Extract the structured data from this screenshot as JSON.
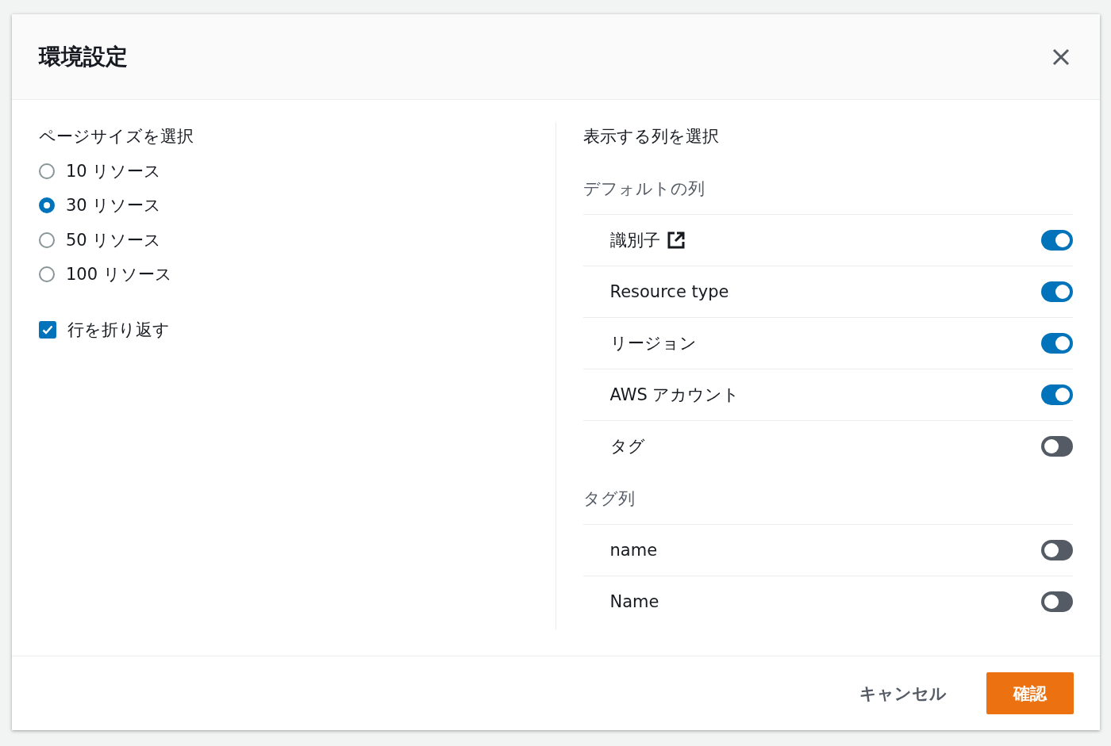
{
  "dialog": {
    "title": "環境設定"
  },
  "page_size": {
    "label": "ページサイズを選択",
    "options": [
      {
        "label": "10 リソース",
        "selected": false
      },
      {
        "label": "30 リソース",
        "selected": true
      },
      {
        "label": "50 リソース",
        "selected": false
      },
      {
        "label": "100 リソース",
        "selected": false
      }
    ]
  },
  "wrap_lines": {
    "label": "行を折り返す",
    "checked": true
  },
  "columns": {
    "label": "表示する列を選択",
    "groups": [
      {
        "label": "デフォルトの列",
        "items": [
          {
            "label": "識別子",
            "external_link": true,
            "on": true
          },
          {
            "label": "Resource type",
            "external_link": false,
            "on": true
          },
          {
            "label": "リージョン",
            "external_link": false,
            "on": true
          },
          {
            "label": "AWS アカウント",
            "external_link": false,
            "on": true
          },
          {
            "label": "タグ",
            "external_link": false,
            "on": false
          }
        ]
      },
      {
        "label": "タグ列",
        "items": [
          {
            "label": "name",
            "external_link": false,
            "on": false
          },
          {
            "label": "Name",
            "external_link": false,
            "on": false
          }
        ]
      }
    ]
  },
  "buttons": [
    {
      "label": "キャンセル",
      "kind": "link"
    },
    {
      "label": "確認",
      "kind": "primary"
    }
  ]
}
